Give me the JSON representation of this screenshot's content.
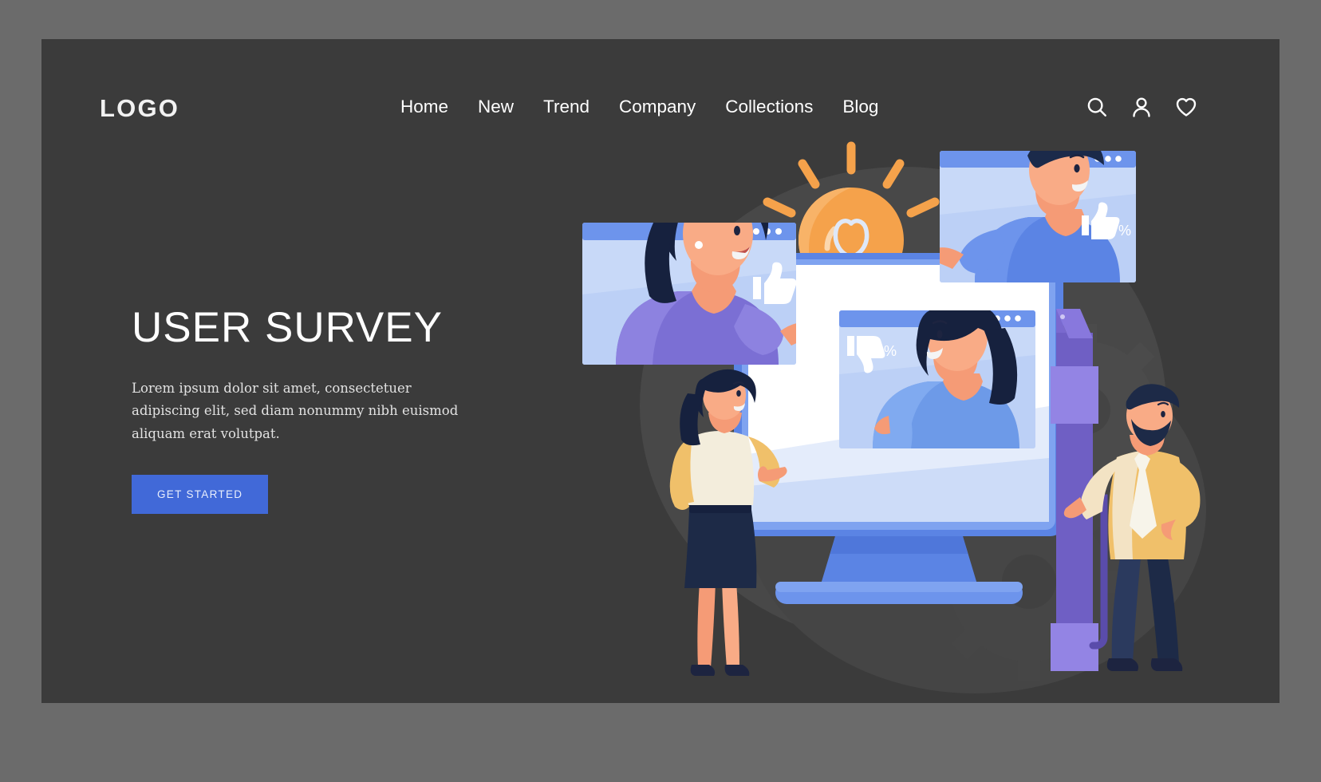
{
  "page": {
    "background_color": "#3b3b3b",
    "outer_frame_color": "#6b6b6b"
  },
  "header": {
    "logo": "LOGO",
    "nav": [
      {
        "label": "Home"
      },
      {
        "label": "New"
      },
      {
        "label": "Trend"
      },
      {
        "label": "Company"
      },
      {
        "label": "Collections"
      },
      {
        "label": "Blog"
      }
    ],
    "icons": [
      {
        "name": "search-icon"
      },
      {
        "name": "user-account-icon"
      },
      {
        "name": "heart-favorites-icon"
      }
    ]
  },
  "hero": {
    "title": "USER SURVEY",
    "subtitle": "Lorem ipsum dolor sit amet, consectetuer adipiscing elit, sed diam nonummy nibh euismod aliquam erat volutpat.",
    "cta_label": "GET STARTED",
    "cta_color": "#4169d8",
    "title_color": "#ffffff"
  },
  "illustration": {
    "name": "user-survey-video-call-illustration",
    "badges": [
      {
        "name": "thumbs-up-percent-badge",
        "symbol": "%"
      },
      {
        "name": "thumbs-up-percent-badge",
        "symbol": "%"
      },
      {
        "name": "thumbs-down-percent-badge",
        "symbol": "%"
      }
    ],
    "colors": {
      "monitor_frame": "#6d94ec",
      "monitor_screen": "#ffffff",
      "window_body": "#c8d9f8",
      "window_titlebar": "#6d94ec",
      "bulb": "#f5a24b",
      "bulb_base": "#4f7fe0",
      "gear": "#4a4a4a",
      "blob": "#4a4a4a",
      "skin": "#f59b76",
      "hair_dark": "#16213e",
      "purple_shirt": "#7b6fd4",
      "blue_shirt": "#5b84e4",
      "yellow_shirt": "#f0c06a",
      "pen_purple": "#6f5fc4"
    }
  }
}
